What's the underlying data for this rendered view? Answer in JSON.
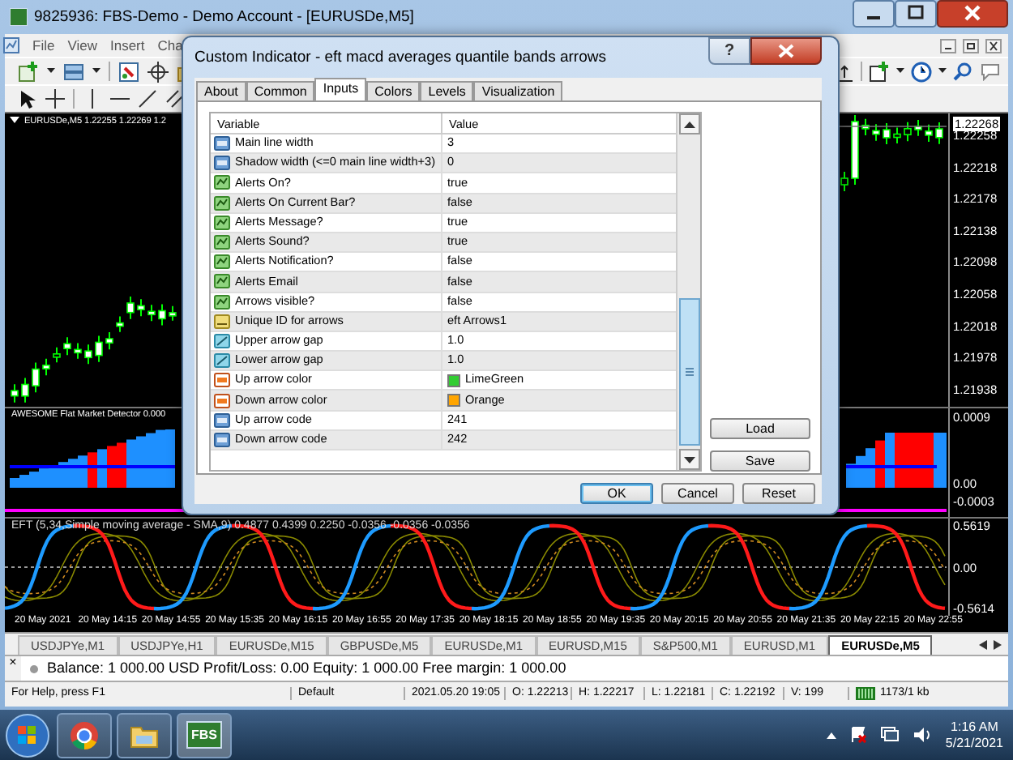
{
  "main_window": {
    "title": "9825936: FBS-Demo - Demo Account - [EURUSDe,M5]"
  },
  "menu": [
    "File",
    "View",
    "Insert",
    "Cha"
  ],
  "chart": {
    "header": "EURUSDe,M5  1.22255 1.22269 1.2",
    "price_labels": [
      {
        "text": "1.22268",
        "kind": "current"
      },
      {
        "text": "1.22258",
        "kind": "tick"
      },
      {
        "text": "1.22218",
        "kind": "tick"
      },
      {
        "text": "1.22178",
        "kind": "tick"
      },
      {
        "text": "1.22138",
        "kind": "tick"
      },
      {
        "text": "1.22098",
        "kind": "tick"
      },
      {
        "text": "1.22058",
        "kind": "tick"
      },
      {
        "text": "1.22018",
        "kind": "tick"
      },
      {
        "text": "1.21978",
        "kind": "tick"
      },
      {
        "text": "1.21938",
        "kind": "tick"
      }
    ]
  },
  "oscillator": {
    "header": "AWESOME Flat Market Detector  0.000",
    "axis_labels": [
      "0.0009",
      "0.00",
      "-0.0003"
    ]
  },
  "eft": {
    "header": "EFT (5,34,Simple moving average - SMA,9) 0.4877 0.4399 0.2250 -0.0356 -0.0356 -0.0356",
    "axis_labels": [
      "0.5619",
      "0.00",
      "-0.5614"
    ]
  },
  "time_axis": [
    "20 May 2021",
    "20 May 14:15",
    "20 May 14:55",
    "20 May 15:35",
    "20 May 16:15",
    "20 May 16:55",
    "20 May 17:35",
    "20 May 18:15",
    "20 May 18:55",
    "20 May 19:35",
    "20 May 20:15",
    "20 May 20:55",
    "20 May 21:35",
    "20 May 22:15",
    "20 May 22:55"
  ],
  "chart_tabs": [
    {
      "label": "USDJPYe,M1",
      "selected": false
    },
    {
      "label": "USDJPYe,H1",
      "selected": false
    },
    {
      "label": "EURUSDe,M15",
      "selected": false
    },
    {
      "label": "GBPUSDe,M5",
      "selected": false
    },
    {
      "label": "EURUSDe,M1",
      "selected": false
    },
    {
      "label": "EURUSD,M15",
      "selected": false
    },
    {
      "label": "S&P500,M1",
      "selected": false
    },
    {
      "label": "EURUSD,M1",
      "selected": false
    },
    {
      "label": "EURUSDe,M5",
      "selected": true
    }
  ],
  "terminal": {
    "close": "×",
    "text": "Balance: 1 000.00 USD  Profit/Loss: 0.00  Equity: 1 000.00  Free margin: 1 000.00"
  },
  "status_bar": [
    {
      "text": "For Help, press F1",
      "kind": "text"
    },
    {
      "text": "Default",
      "kind": "text"
    },
    {
      "text": "2021.05.20 19:05",
      "kind": "text"
    },
    {
      "text": "O: 1.22213",
      "kind": "text"
    },
    {
      "text": "H: 1.22217",
      "kind": "text"
    },
    {
      "text": "L: 1.22181",
      "kind": "text"
    },
    {
      "text": "C: 1.22192",
      "kind": "text"
    },
    {
      "text": "V: 199",
      "kind": "text"
    },
    {
      "text": "1173/1 kb",
      "kind": "traffic"
    }
  ],
  "taskbar": {
    "app_label": "FBS",
    "time": "1:16 AM",
    "date": "5/21/2021"
  },
  "dialog": {
    "title": "Custom Indicator - eft macd averages quantile bands  arrows",
    "help": "?",
    "tabs": [
      {
        "label": "About",
        "selected": false
      },
      {
        "label": "Common",
        "selected": false
      },
      {
        "label": "Inputs",
        "selected": true
      },
      {
        "label": "Colors",
        "selected": false
      },
      {
        "label": "Levels",
        "selected": false
      },
      {
        "label": "Visualization",
        "selected": false
      }
    ],
    "columns": [
      "Variable",
      "Value"
    ],
    "rows": [
      {
        "kind": "int",
        "variable": "Main line width",
        "value": "3"
      },
      {
        "kind": "int",
        "variable": "Shadow width (<=0 main line width+3)",
        "value": "0"
      },
      {
        "kind": "bool",
        "variable": "Alerts On?",
        "value": "true"
      },
      {
        "kind": "bool",
        "variable": "Alerts On Current Bar?",
        "value": "false"
      },
      {
        "kind": "bool",
        "variable": "Alerts Message?",
        "value": "true"
      },
      {
        "kind": "bool",
        "variable": "Alerts Sound?",
        "value": "true"
      },
      {
        "kind": "bool",
        "variable": "Alerts Notification?",
        "value": "false"
      },
      {
        "kind": "bool",
        "variable": "Alerts Email",
        "value": "false"
      },
      {
        "kind": "bool",
        "variable": "Arrows visible?",
        "value": "false"
      },
      {
        "kind": "string",
        "variable": "Unique ID for arrows",
        "value": "eft Arrows1"
      },
      {
        "kind": "double",
        "variable": "Upper arrow gap",
        "value": "1.0"
      },
      {
        "kind": "double",
        "variable": "Lower arrow gap",
        "value": "1.0"
      },
      {
        "kind": "color",
        "variable": "Up arrow color",
        "value": "LimeGreen",
        "color": "#32cd32"
      },
      {
        "kind": "color",
        "variable": "Down arrow color",
        "value": "Orange",
        "color": "#ffa500"
      },
      {
        "kind": "int",
        "variable": "Up arrow code",
        "value": "241"
      },
      {
        "kind": "int",
        "variable": "Down arrow code",
        "value": "242"
      }
    ],
    "side_buttons": [
      "Load",
      "Save"
    ],
    "buttons": [
      {
        "label": "OK",
        "default": true
      },
      {
        "label": "Cancel",
        "default": false
      },
      {
        "label": "Reset",
        "default": false
      }
    ]
  }
}
